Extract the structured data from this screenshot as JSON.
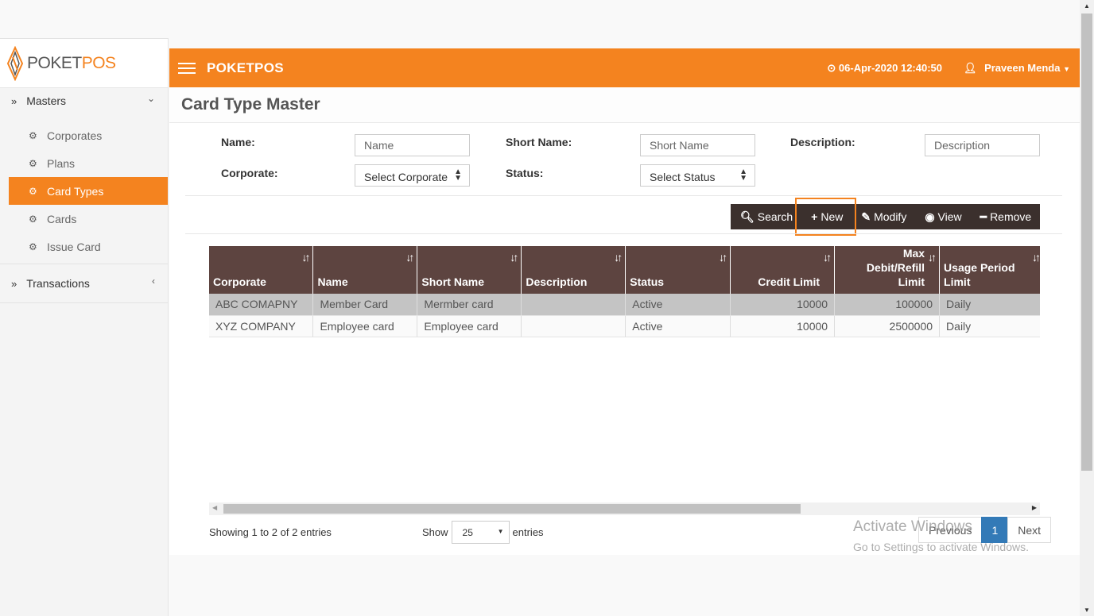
{
  "sidebar": {
    "logo": {
      "part1": "POKET",
      "part2": "POS"
    },
    "masters_label": "Masters",
    "items": [
      {
        "label": "Corporates"
      },
      {
        "label": "Plans"
      },
      {
        "label": "Card Types"
      },
      {
        "label": "Cards"
      },
      {
        "label": "Issue Card"
      }
    ],
    "active_item": "Card Types",
    "transactions_label": "Transactions"
  },
  "header": {
    "brand": "POKETPOS",
    "datetime": "06-Apr-2020 12:40:50",
    "user": "Praveen Menda"
  },
  "page": {
    "title": "Card Type Master"
  },
  "filters": {
    "name_label": "Name:",
    "name_placeholder": "Name",
    "short_name_label": "Short Name:",
    "short_name_placeholder": "Short Name",
    "description_label": "Description:",
    "description_placeholder": "Description",
    "corporate_label": "Corporate:",
    "corporate_value": "Select Corporate",
    "status_label": "Status:",
    "status_value": "Select Status"
  },
  "toolbar": {
    "search": "Search",
    "new": "New",
    "modify": "Modify",
    "view": "View",
    "remove": "Remove"
  },
  "table": {
    "columns": [
      "Corporate",
      "Name",
      "Short Name",
      "Description",
      "Status",
      "Credit Limit",
      "Max Debit/Refill Limit",
      "Usage Period Limit"
    ],
    "rows": [
      [
        "ABC COMAPNY",
        "Member Card",
        "Mermber card",
        "",
        "Active",
        "10000",
        "100000",
        "Daily"
      ],
      [
        "XYZ COMPANY",
        "Employee card",
        "Employee card",
        "",
        "Active",
        "10000",
        "2500000",
        "Daily"
      ]
    ]
  },
  "footer": {
    "info": "Showing 1 to 2 of 2 entries",
    "show_label": "Show",
    "page_size": "25",
    "entries_label": "entries",
    "previous": "Previous",
    "current_page": "1",
    "next": "Next"
  },
  "watermark": {
    "line1": "Activate Windows",
    "line2": "Go to Settings to activate Windows."
  },
  "colors": {
    "accent": "#f4831f",
    "table_header": "#5d4440",
    "toolbar": "#3b302d",
    "pager_active": "#337ab7"
  }
}
